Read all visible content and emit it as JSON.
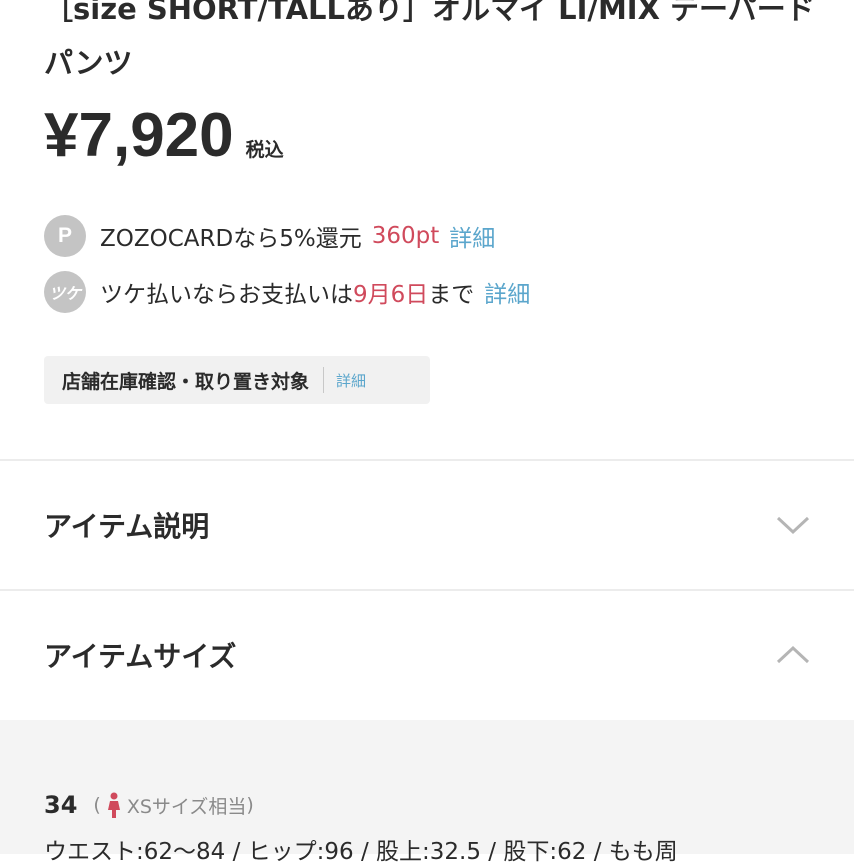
{
  "product": {
    "title": "［size SHORT/TALLあり］オルマイ LI/MIX テーパード パンツ",
    "price": "¥7,920",
    "tax_label": "税込"
  },
  "points": {
    "icon_label": "P",
    "text": "ZOZOCARDなら5%還元",
    "value": "360pt",
    "link": "詳細"
  },
  "tsuke": {
    "icon_label": "ツケ",
    "text_before": "ツケ払いならお支払いは",
    "date": "9月6日",
    "text_after": "まで",
    "link": "詳細"
  },
  "store": {
    "label": "店舗在庫確認・取り置き対象",
    "link": "詳細"
  },
  "sections": {
    "description_title": "アイテム説明",
    "size_title": "アイテムサイズ"
  },
  "size": {
    "number": "34",
    "note_open": "(",
    "note": "XSサイズ相当",
    "note_close": ")",
    "detail": "ウエスト:62～84 / ヒップ:96 / 股上:32.5 / 股下:62 / もも周"
  },
  "colors": {
    "accent_red": "#d04a5c",
    "link_blue": "#5ba6cc",
    "icon_gray": "#c4c4c4",
    "person_icon": "#d04a5c"
  },
  "icons": {
    "points": "points-p-icon",
    "tsuke": "tsuke-icon",
    "description_toggle": "chevron-down-icon",
    "size_toggle": "chevron-up-icon",
    "size_person": "person-icon"
  }
}
